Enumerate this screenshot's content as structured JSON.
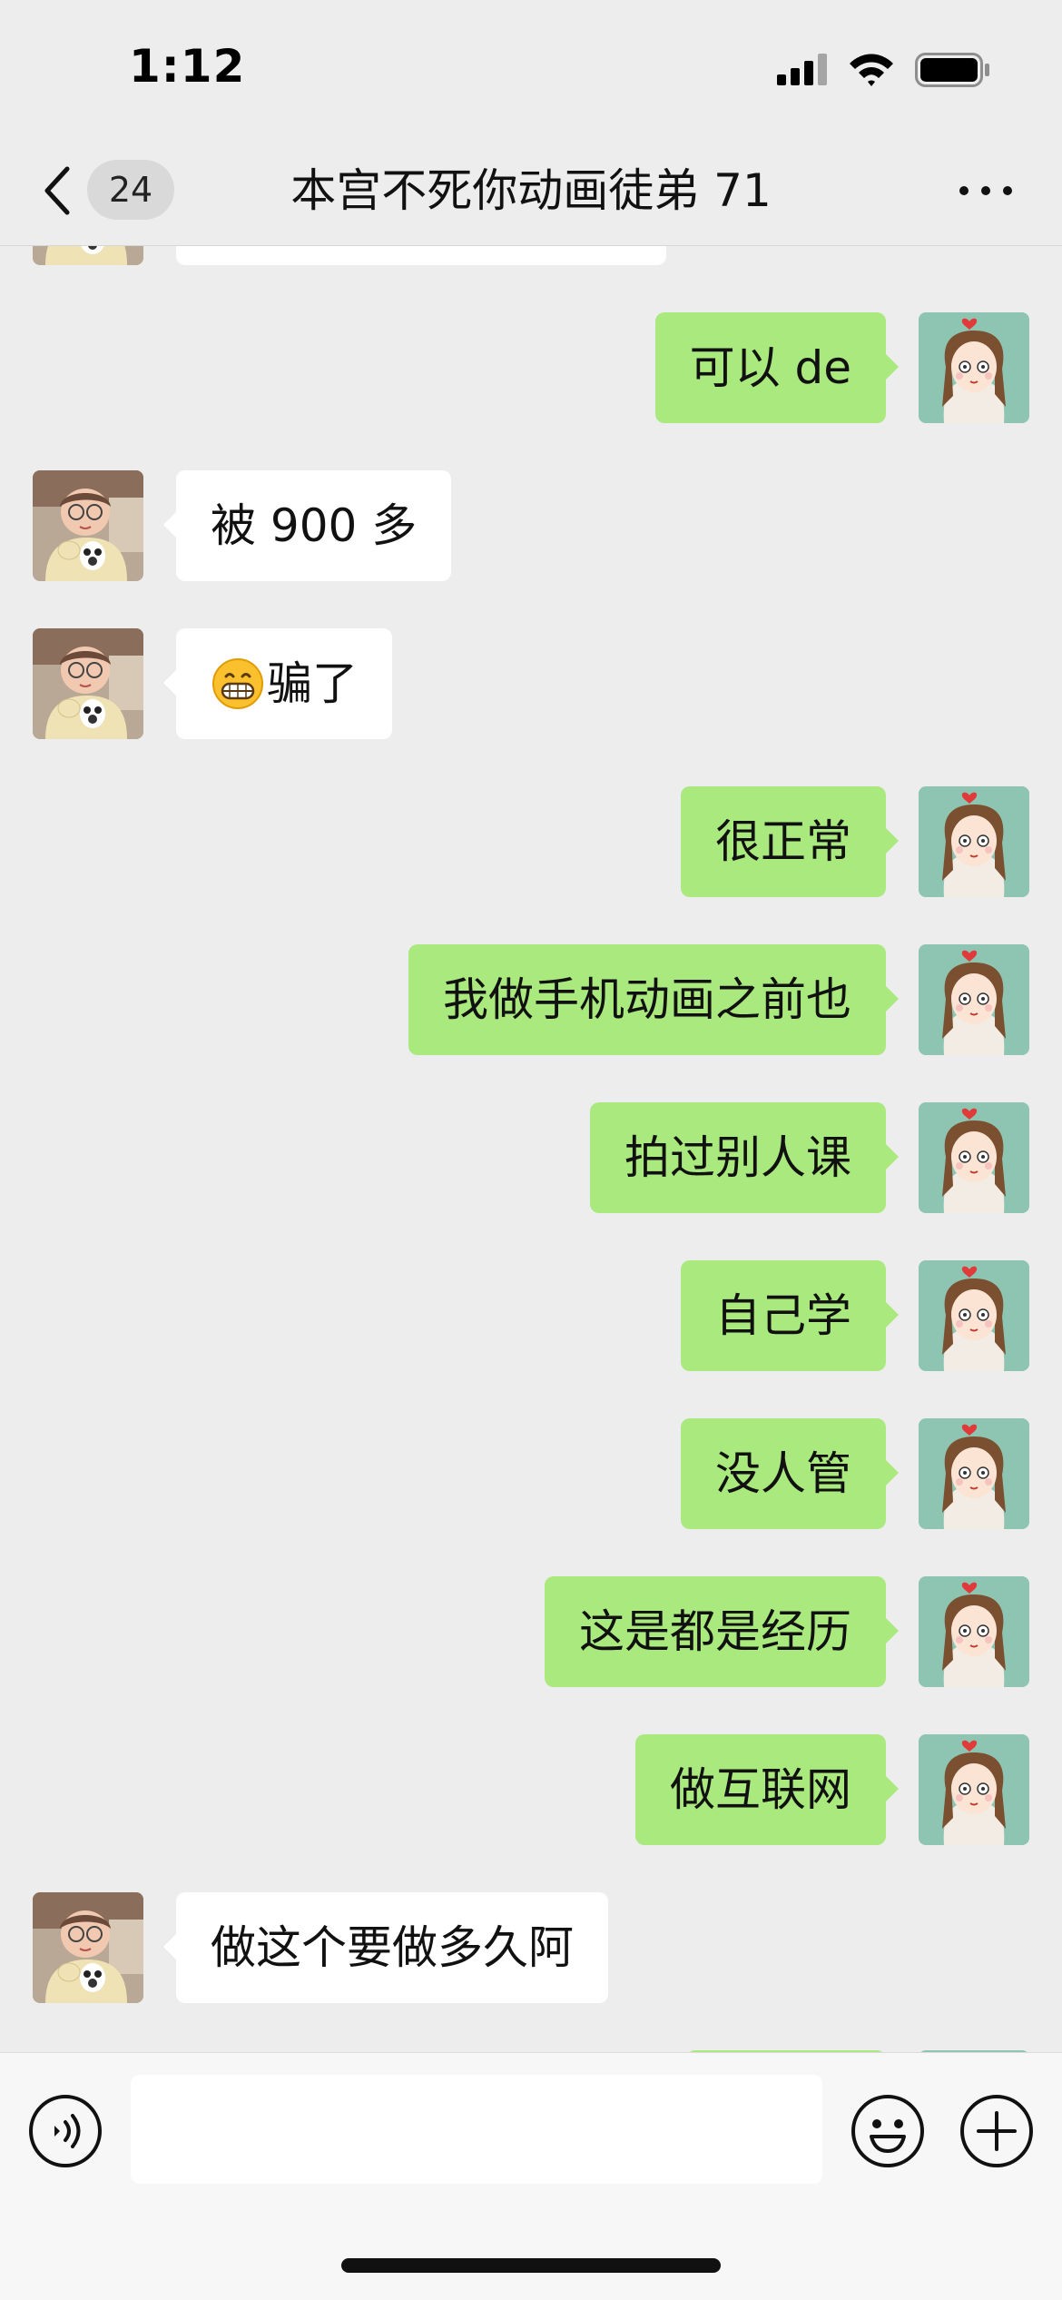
{
  "status_bar": {
    "time": "1:12",
    "icons": [
      "signal-icon",
      "wifi-icon",
      "battery-icon"
    ]
  },
  "nav": {
    "unread_count": "24",
    "title": "本宫不死你动画徒弟 71",
    "icons": [
      "back-icon",
      "more-icon"
    ]
  },
  "messages": [
    {
      "side": "left",
      "text": "",
      "partial": true
    },
    {
      "side": "right",
      "text": "可以 de"
    },
    {
      "side": "left",
      "text": "被 900 多"
    },
    {
      "side": "left",
      "text": "骗了",
      "emoji": "grinning-face-icon"
    },
    {
      "side": "right",
      "text": "很正常"
    },
    {
      "side": "right",
      "text": "我做手机动画之前也"
    },
    {
      "side": "right",
      "text": "拍过别人课"
    },
    {
      "side": "right",
      "text": "自己学"
    },
    {
      "side": "right",
      "text": "没人管"
    },
    {
      "side": "right",
      "text": "这是都是经历"
    },
    {
      "side": "right",
      "text": "做互联网"
    },
    {
      "side": "left",
      "text": "做这个要做多久阿"
    },
    {
      "side": "right",
      "text": "",
      "partial": true
    }
  ],
  "input_bar": {
    "value": "",
    "icons": [
      "voice-icon",
      "emoji-icon",
      "plus-icon"
    ]
  },
  "colors": {
    "background": "#ededed",
    "own_bubble": "#a9e97e",
    "other_bubble": "#ffffff",
    "own_avatar_bg": "#8ec5b2"
  }
}
